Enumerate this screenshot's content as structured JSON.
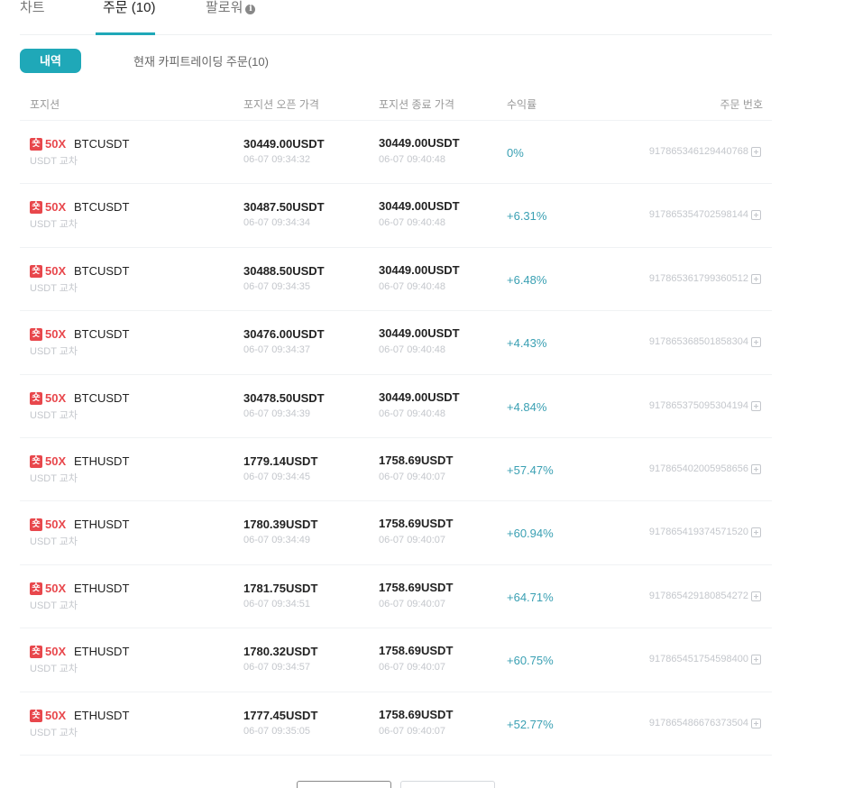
{
  "tabs": [
    {
      "label": "차트"
    },
    {
      "label": "주문 (10)"
    },
    {
      "label": "팔로워"
    }
  ],
  "subtabs": {
    "history": "내역",
    "current": "현재 카피트레이딩 주문(10)"
  },
  "columns": {
    "position": "포지션",
    "open_price": "포지션 오픈 가격",
    "close_price": "포지션 종료 가격",
    "roi": "수익률",
    "order_no": "주문 번호"
  },
  "rows": [
    {
      "badge": "숏",
      "leverage": "50X",
      "symbol": "BTCUSDT",
      "margin": "USDT 교차",
      "open_price": "30449.00USDT",
      "open_time": "06-07 09:34:32",
      "close_price": "30449.00USDT",
      "close_time": "06-07 09:40:48",
      "roi": "0%",
      "order_no": "917865346129440768"
    },
    {
      "badge": "숏",
      "leverage": "50X",
      "symbol": "BTCUSDT",
      "margin": "USDT 교차",
      "open_price": "30487.50USDT",
      "open_time": "06-07 09:34:34",
      "close_price": "30449.00USDT",
      "close_time": "06-07 09:40:48",
      "roi": "+6.31%",
      "order_no": "917865354702598144"
    },
    {
      "badge": "숏",
      "leverage": "50X",
      "symbol": "BTCUSDT",
      "margin": "USDT 교차",
      "open_price": "30488.50USDT",
      "open_time": "06-07 09:34:35",
      "close_price": "30449.00USDT",
      "close_time": "06-07 09:40:48",
      "roi": "+6.48%",
      "order_no": "917865361799360512"
    },
    {
      "badge": "숏",
      "leverage": "50X",
      "symbol": "BTCUSDT",
      "margin": "USDT 교차",
      "open_price": "30476.00USDT",
      "open_time": "06-07 09:34:37",
      "close_price": "30449.00USDT",
      "close_time": "06-07 09:40:48",
      "roi": "+4.43%",
      "order_no": "917865368501858304"
    },
    {
      "badge": "숏",
      "leverage": "50X",
      "symbol": "BTCUSDT",
      "margin": "USDT 교차",
      "open_price": "30478.50USDT",
      "open_time": "06-07 09:34:39",
      "close_price": "30449.00USDT",
      "close_time": "06-07 09:40:48",
      "roi": "+4.84%",
      "order_no": "917865375095304194"
    },
    {
      "badge": "숏",
      "leverage": "50X",
      "symbol": "ETHUSDT",
      "margin": "USDT 교차",
      "open_price": "1779.14USDT",
      "open_time": "06-07 09:34:45",
      "close_price": "1758.69USDT",
      "close_time": "06-07 09:40:07",
      "roi": "+57.47%",
      "order_no": "917865402005958656"
    },
    {
      "badge": "숏",
      "leverage": "50X",
      "symbol": "ETHUSDT",
      "margin": "USDT 교차",
      "open_price": "1780.39USDT",
      "open_time": "06-07 09:34:49",
      "close_price": "1758.69USDT",
      "close_time": "06-07 09:40:07",
      "roi": "+60.94%",
      "order_no": "917865419374571520"
    },
    {
      "badge": "숏",
      "leverage": "50X",
      "symbol": "ETHUSDT",
      "margin": "USDT 교차",
      "open_price": "1781.75USDT",
      "open_time": "06-07 09:34:51",
      "close_price": "1758.69USDT",
      "close_time": "06-07 09:40:07",
      "roi": "+64.71%",
      "order_no": "917865429180854272"
    },
    {
      "badge": "숏",
      "leverage": "50X",
      "symbol": "ETHUSDT",
      "margin": "USDT 교차",
      "open_price": "1780.32USDT",
      "open_time": "06-07 09:34:57",
      "close_price": "1758.69USDT",
      "close_time": "06-07 09:40:07",
      "roi": "+60.75%",
      "order_no": "917865451754598400"
    },
    {
      "badge": "숏",
      "leverage": "50X",
      "symbol": "ETHUSDT",
      "margin": "USDT 교차",
      "open_price": "1777.45USDT",
      "open_time": "06-07 09:35:05",
      "close_price": "1758.69USDT",
      "close_time": "06-07 09:40:07",
      "roi": "+52.77%",
      "order_no": "917865486676373504"
    }
  ],
  "colors": {
    "accent": "#1fa8b8",
    "short": "#e8474c",
    "roi": "#3aa0b3"
  },
  "icons": {
    "info": "info-icon",
    "copy": "copy-icon"
  }
}
